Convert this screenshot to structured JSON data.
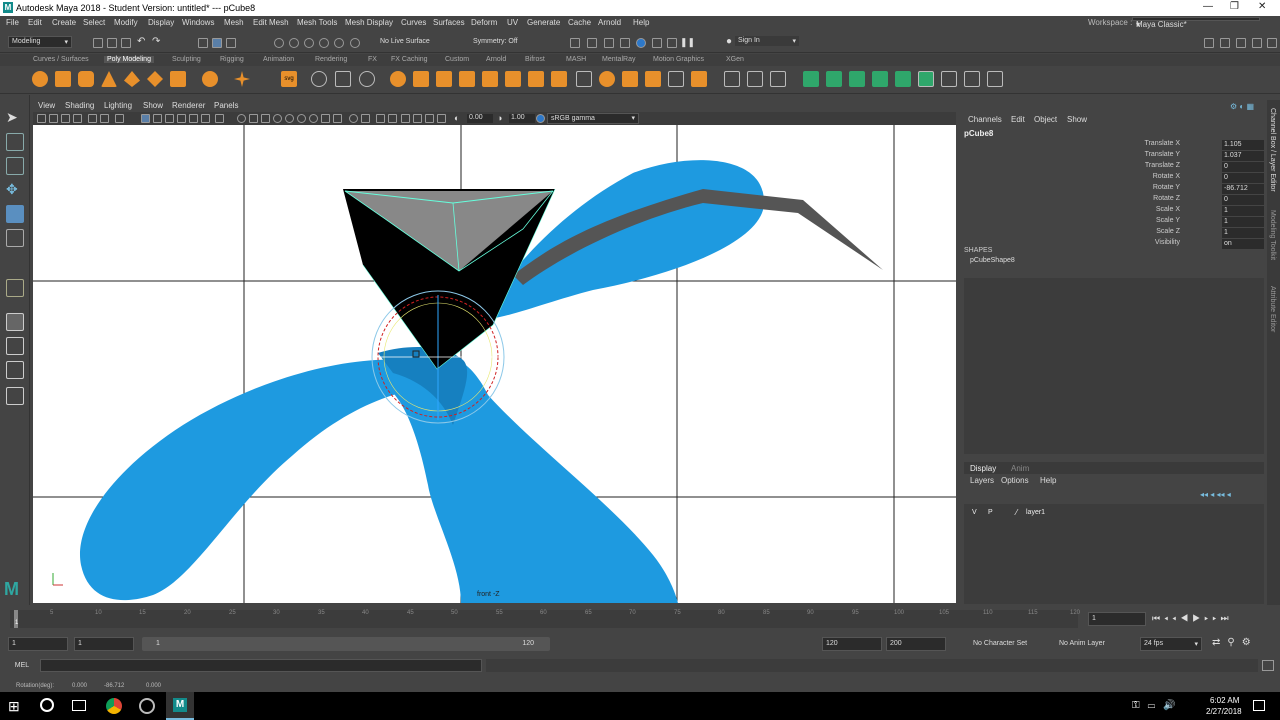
{
  "window": {
    "title": "Autodesk Maya 2018 - Student Version: untitled*   ---   pCube8",
    "logo": "M"
  },
  "menus": [
    "File",
    "Edit",
    "Create",
    "Select",
    "Modify",
    "Display",
    "Windows",
    "Mesh",
    "Edit Mesh",
    "Mesh Tools",
    "Mesh Display",
    "Curves",
    "Surfaces",
    "Deform",
    "UV",
    "Generate",
    "Cache",
    "Arnold",
    "Help"
  ],
  "workspace": {
    "label": "Workspace :",
    "value": "Maya Classic*"
  },
  "statusline": {
    "menuset": "Modeling",
    "live_surface": "No Live Surface",
    "symmetry": "Symmetry: Off",
    "sign_in": "Sign In"
  },
  "shelf_tabs": [
    "Curves / Surfaces",
    "Poly Modeling",
    "Sculpting",
    "Rigging",
    "Animation",
    "Rendering",
    "FX",
    "FX Caching",
    "Custom",
    "Arnold",
    "Bifrost",
    "MASH",
    "MentalRay",
    "Motion Graphics",
    "XGen"
  ],
  "active_shelf": "Poly Modeling",
  "viewport": {
    "menus": [
      "View",
      "Shading",
      "Lighting",
      "Show",
      "Renderer",
      "Panels"
    ],
    "exposure": "0.00",
    "gamma": "1.00",
    "color_space": "sRGB gamma",
    "camera_label": "front -Z"
  },
  "channel_box": {
    "menus": [
      "Channels",
      "Edit",
      "Object",
      "Show"
    ],
    "object": "pCube8",
    "attributes": [
      {
        "name": "Translate X",
        "value": "1.105"
      },
      {
        "name": "Translate Y",
        "value": "1.037"
      },
      {
        "name": "Translate Z",
        "value": "0"
      },
      {
        "name": "Rotate X",
        "value": "0"
      },
      {
        "name": "Rotate Y",
        "value": "-86.712"
      },
      {
        "name": "Rotate Z",
        "value": "0"
      },
      {
        "name": "Scale X",
        "value": "1"
      },
      {
        "name": "Scale Y",
        "value": "1"
      },
      {
        "name": "Scale Z",
        "value": "1"
      },
      {
        "name": "Visibility",
        "value": "on"
      }
    ],
    "shapes_label": "SHAPES",
    "shape": "pCubeShape8"
  },
  "layer_editor": {
    "tabs": [
      "Display",
      "Anim"
    ],
    "menus": [
      "Layers",
      "Options",
      "Help"
    ],
    "layer": {
      "v": "V",
      "p": "P",
      "name": "layer1"
    }
  },
  "side_tabs": [
    "Channel Box / Layer Editor",
    "Modeling Toolkit",
    "Attribute Editor"
  ],
  "timeline": {
    "ticks": [
      "1",
      "5",
      "10",
      "15",
      "20",
      "25",
      "30",
      "35",
      "40",
      "45",
      "50",
      "55",
      "60",
      "65",
      "70",
      "75",
      "80",
      "85",
      "90",
      "95",
      "100",
      "105",
      "110",
      "115",
      "120"
    ],
    "current_frame": "1"
  },
  "range": {
    "start": "1",
    "inner_start": "1",
    "slider_start": "1",
    "slider_end": "120",
    "inner_end": "120",
    "end": "200",
    "character_set": "No Character Set",
    "anim_layer": "No Anim Layer",
    "fps": "24 fps"
  },
  "command_line": {
    "label": "MEL"
  },
  "help_line": {
    "label": "Rotation(deg):",
    "x": "0.000",
    "y": "-86.712",
    "z": "0.000"
  },
  "taskbar": {
    "time": "6:02 AM",
    "date": "2/27/2018"
  },
  "colors": {
    "blue_shape": "#1e9ae0",
    "manipulator_red": "#d02020",
    "accent_teal": "#2fa7a1"
  }
}
